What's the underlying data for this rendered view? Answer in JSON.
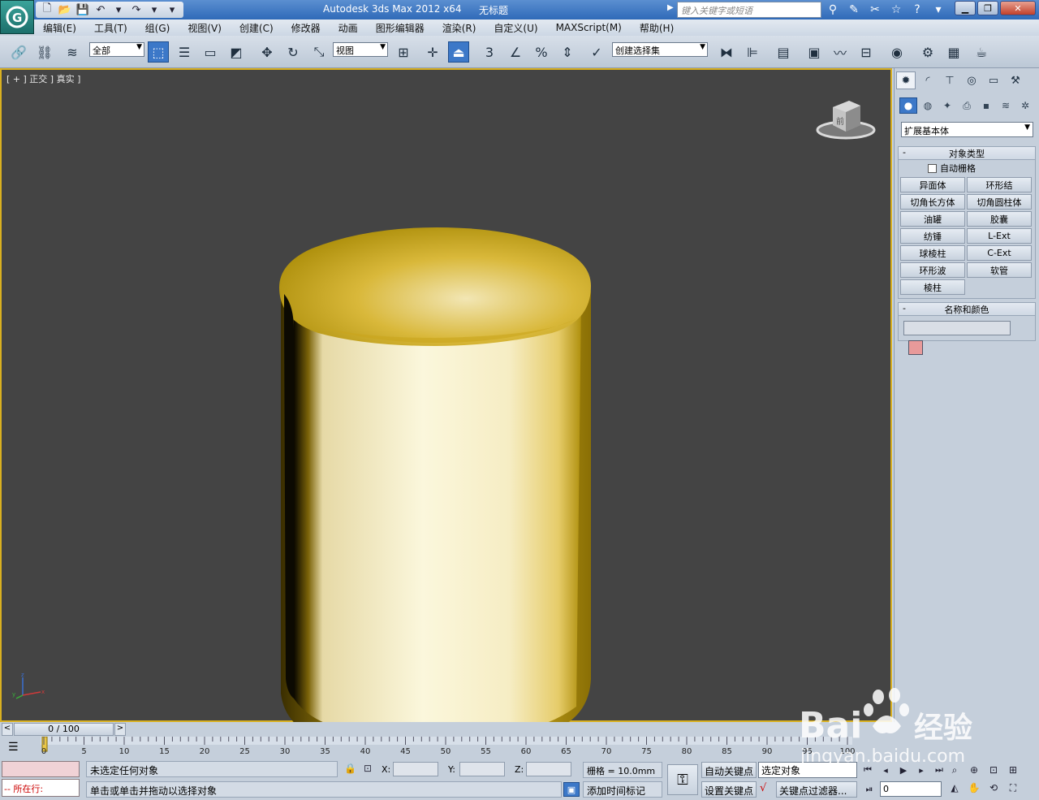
{
  "titlebar": {
    "app_title": "Autodesk 3ds Max  2012 x64",
    "doc_title": "无标题",
    "search_placeholder": "键入关键字或短语"
  },
  "menubar": {
    "items": [
      "编辑(E)",
      "工具(T)",
      "组(G)",
      "视图(V)",
      "创建(C)",
      "修改器",
      "动画",
      "图形编辑器",
      "渲染(R)",
      "自定义(U)",
      "MAXScript(M)",
      "帮助(H)"
    ]
  },
  "toolbar": {
    "selection_filter": "全部",
    "reference_coord": "视图",
    "named_selection_set": "创建选择集",
    "snap_value": "3"
  },
  "viewport": {
    "label": "[ + ] 正交 ] 真实 ]",
    "viewcube_face": "前",
    "object_color_light": "#fbf4d6",
    "object_color_dark": "#b08f08"
  },
  "command_panel": {
    "category": "扩展基本体",
    "object_type_title": "对象类型",
    "autogrid_label": "自动栅格",
    "object_buttons": [
      "异面体",
      "环形结",
      "切角长方体",
      "切角圆柱体",
      "油罐",
      "胶囊",
      "纺锤",
      "L-Ext",
      "球棱柱",
      "C-Ext",
      "环形波",
      "软管",
      "棱柱"
    ],
    "name_color_title": "名称和颜色",
    "swatch_color": "#e89a9a"
  },
  "timeline": {
    "slider_text": "0 / 100",
    "ticks": [
      "0",
      "5",
      "10",
      "15",
      "20",
      "25",
      "30",
      "35",
      "40",
      "45",
      "50",
      "55",
      "60",
      "65",
      "70",
      "75",
      "80",
      "85",
      "90",
      "95",
      "100"
    ]
  },
  "status": {
    "maxscript_prompt": "-- 所在行:",
    "selection_status": "未选定任何对象",
    "prompt": "单击或单击并拖动以选择对象",
    "x_label": "X:",
    "y_label": "Y:",
    "z_label": "Z:",
    "grid": "栅格 = 10.0mm",
    "add_time_tag": "添加时间标记",
    "auto_key": "自动关键点",
    "set_key": "设置关键点",
    "selected_set": "选定对象",
    "key_filters": "关键点过滤器...",
    "frame": "0"
  },
  "watermark": {
    "brand": "Bai",
    "brand_cn": "经验",
    "url": "jingyan.baidu.com"
  }
}
